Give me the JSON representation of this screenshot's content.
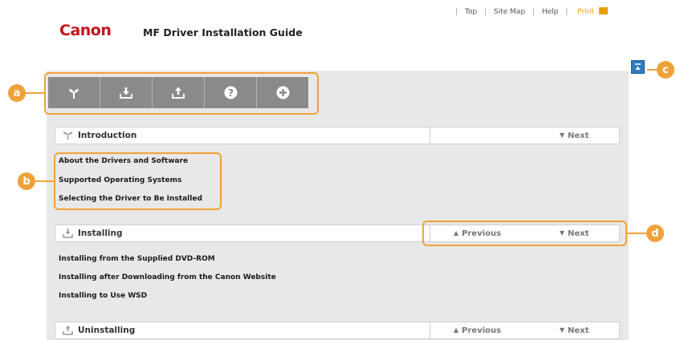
{
  "header": {
    "logo": "Canon",
    "title": "MF Driver Installation Guide",
    "links": {
      "top": "Top",
      "sitemap": "Site Map",
      "help": "Help",
      "print": "Print"
    }
  },
  "toolbar": {
    "buttons": [
      "sprout-icon",
      "download-icon",
      "upload-icon",
      "help-icon",
      "plus-icon"
    ]
  },
  "sections": [
    {
      "title": "Introduction",
      "next": "Next",
      "links": [
        "About the Drivers and Software",
        "Supported Operating Systems",
        "Selecting the Driver to Be Installed"
      ]
    },
    {
      "title": "Installing",
      "previous": "Previous",
      "next": "Next",
      "links": [
        "Installing from the Supplied DVD-ROM",
        "Installing after Downloading from the Canon Website",
        "Installing to Use WSD"
      ]
    },
    {
      "title": "Uninstalling",
      "previous": "Previous",
      "next": "Next"
    }
  ],
  "callouts": {
    "a": "a",
    "b": "b",
    "c": "c",
    "d": "d"
  },
  "colors": {
    "callout": "#f0a23a",
    "logo": "#c4161c",
    "toolbar": "#8a8a8a",
    "top_button": "#2f7bbf"
  }
}
